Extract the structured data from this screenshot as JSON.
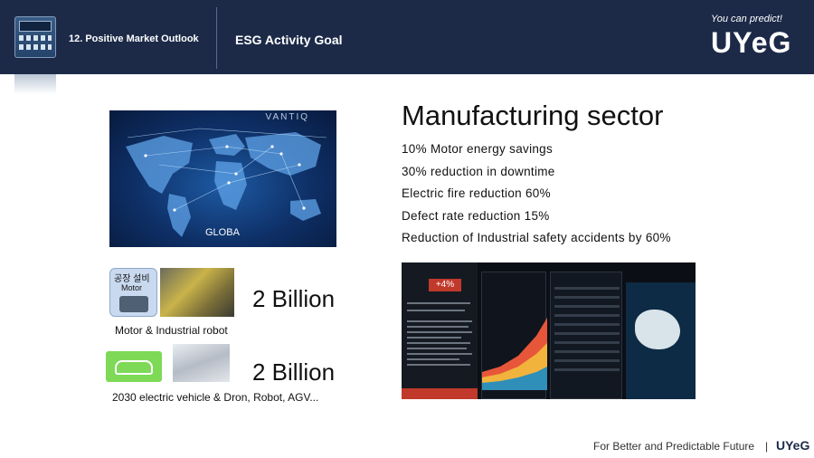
{
  "header": {
    "section_label": "12. Positive Market Outlook",
    "title": "ESG Activity Goal",
    "tagline": "You can predict!",
    "logo": "UYeG"
  },
  "left": {
    "map_watermark": "VANTIQ",
    "map_caption": "GLOBA",
    "motor_card": {
      "label_ko": "공장 설비",
      "label_en": "Motor"
    },
    "group1": {
      "caption": "Motor & Industrial robot",
      "figure": "2 Billion"
    },
    "group2": {
      "caption": "2030 electric vehicle & Dron, Robot, AGV...",
      "figure": "2 Billion"
    }
  },
  "right": {
    "title": "Manufacturing sector",
    "goals": [
      "10% Motor energy savings",
      "30% reduction  in downtime",
      "Electric  fire  reduction  60%",
      "Defect rate  reduction  15%",
      "Reduction  of  Industrial  safety  accidents  by  60%"
    ],
    "dashboard": {
      "badge": "+4%"
    }
  },
  "footer": {
    "text": "For Better and Predictable Future",
    "separator": "|",
    "logo": "UYeG"
  }
}
